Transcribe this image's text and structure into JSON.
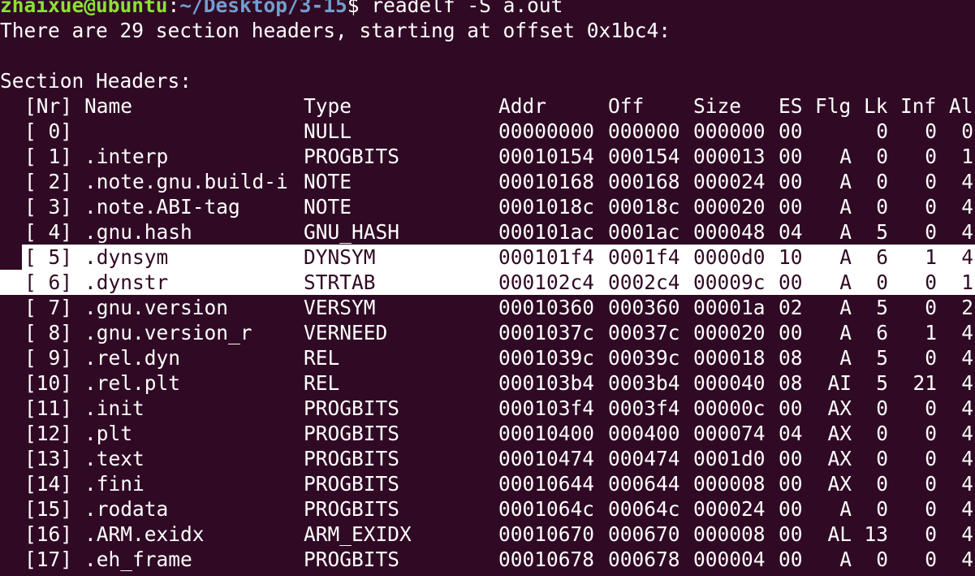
{
  "prompt": {
    "user": "zhaixue@ubuntu",
    "sep": ":",
    "path": "~/Desktop/3-15",
    "dollar": "$",
    "command": " readelf -S a.out"
  },
  "summary": "There are 29 section headers, starting at offset 0x1bc4:",
  "section_title": "Section Headers:",
  "headers": {
    "nr": "[Nr]",
    "name": "Name",
    "type": "Type",
    "addr": "Addr",
    "off": "Off",
    "size": "Size",
    "es": "ES",
    "flg": "Flg",
    "lk": "Lk",
    "inf": "Inf",
    "al": "Al"
  },
  "sections": [
    {
      "nr": "[ 0]",
      "name": "",
      "type": "NULL",
      "addr": "00000000",
      "off": "000000",
      "size": "000000",
      "es": "00",
      "flg": "",
      "lk": "0",
      "inf": "0",
      "al": "0"
    },
    {
      "nr": "[ 1]",
      "name": ".interp",
      "type": "PROGBITS",
      "addr": "00010154",
      "off": "000154",
      "size": "000013",
      "es": "00",
      "flg": "A",
      "lk": "0",
      "inf": "0",
      "al": "1"
    },
    {
      "nr": "[ 2]",
      "name": ".note.gnu.build-i",
      "type": "NOTE",
      "addr": "00010168",
      "off": "000168",
      "size": "000024",
      "es": "00",
      "flg": "A",
      "lk": "0",
      "inf": "0",
      "al": "4"
    },
    {
      "nr": "[ 3]",
      "name": ".note.ABI-tag",
      "type": "NOTE",
      "addr": "0001018c",
      "off": "00018c",
      "size": "000020",
      "es": "00",
      "flg": "A",
      "lk": "0",
      "inf": "0",
      "al": "4"
    },
    {
      "nr": "[ 4]",
      "name": ".gnu.hash",
      "type": "GNU_HASH",
      "addr": "000101ac",
      "off": "0001ac",
      "size": "000048",
      "es": "04",
      "flg": "A",
      "lk": "5",
      "inf": "0",
      "al": "4"
    },
    {
      "nr": "[ 5]",
      "name": ".dynsym",
      "type": "DYNSYM",
      "addr": "000101f4",
      "off": "0001f4",
      "size": "0000d0",
      "es": "10",
      "flg": "A",
      "lk": "6",
      "inf": "1",
      "al": "4"
    },
    {
      "nr": "[ 6]",
      "name": ".dynstr",
      "type": "STRTAB",
      "addr": "000102c4",
      "off": "0002c4",
      "size": "00009c",
      "es": "00",
      "flg": "A",
      "lk": "0",
      "inf": "0",
      "al": "1"
    },
    {
      "nr": "[ 7]",
      "name": ".gnu.version",
      "type": "VERSYM",
      "addr": "00010360",
      "off": "000360",
      "size": "00001a",
      "es": "02",
      "flg": "A",
      "lk": "5",
      "inf": "0",
      "al": "2"
    },
    {
      "nr": "[ 8]",
      "name": ".gnu.version_r",
      "type": "VERNEED",
      "addr": "0001037c",
      "off": "00037c",
      "size": "000020",
      "es": "00",
      "flg": "A",
      "lk": "6",
      "inf": "1",
      "al": "4"
    },
    {
      "nr": "[ 9]",
      "name": ".rel.dyn",
      "type": "REL",
      "addr": "0001039c",
      "off": "00039c",
      "size": "000018",
      "es": "08",
      "flg": "A",
      "lk": "5",
      "inf": "0",
      "al": "4"
    },
    {
      "nr": "[10]",
      "name": ".rel.plt",
      "type": "REL",
      "addr": "000103b4",
      "off": "0003b4",
      "size": "000040",
      "es": "08",
      "flg": "AI",
      "lk": "5",
      "inf": "21",
      "al": "4"
    },
    {
      "nr": "[11]",
      "name": ".init",
      "type": "PROGBITS",
      "addr": "000103f4",
      "off": "0003f4",
      "size": "00000c",
      "es": "00",
      "flg": "AX",
      "lk": "0",
      "inf": "0",
      "al": "4"
    },
    {
      "nr": "[12]",
      "name": ".plt",
      "type": "PROGBITS",
      "addr": "00010400",
      "off": "000400",
      "size": "000074",
      "es": "04",
      "flg": "AX",
      "lk": "0",
      "inf": "0",
      "al": "4"
    },
    {
      "nr": "[13]",
      "name": ".text",
      "type": "PROGBITS",
      "addr": "00010474",
      "off": "000474",
      "size": "0001d0",
      "es": "00",
      "flg": "AX",
      "lk": "0",
      "inf": "0",
      "al": "4"
    },
    {
      "nr": "[14]",
      "name": ".fini",
      "type": "PROGBITS",
      "addr": "00010644",
      "off": "000644",
      "size": "000008",
      "es": "00",
      "flg": "AX",
      "lk": "0",
      "inf": "0",
      "al": "4"
    },
    {
      "nr": "[15]",
      "name": ".rodata",
      "type": "PROGBITS",
      "addr": "0001064c",
      "off": "00064c",
      "size": "000024",
      "es": "00",
      "flg": "A",
      "lk": "0",
      "inf": "0",
      "al": "4"
    },
    {
      "nr": "[16]",
      "name": ".ARM.exidx",
      "type": "ARM_EXIDX",
      "addr": "00010670",
      "off": "000670",
      "size": "000008",
      "es": "00",
      "flg": "AL",
      "lk": "13",
      "inf": "0",
      "al": "4"
    },
    {
      "nr": "[17]",
      "name": ".eh_frame",
      "type": "PROGBITS",
      "addr": "00010678",
      "off": "000678",
      "size": "000004",
      "es": "00",
      "flg": "A",
      "lk": "0",
      "inf": "0",
      "al": "4"
    }
  ],
  "highlighted_rows": [
    5,
    6
  ],
  "colors": {
    "background": "#300a24",
    "text": "#ffffff",
    "user": "#8ae234",
    "path": "#729fcf",
    "selection": "#ffffff"
  }
}
